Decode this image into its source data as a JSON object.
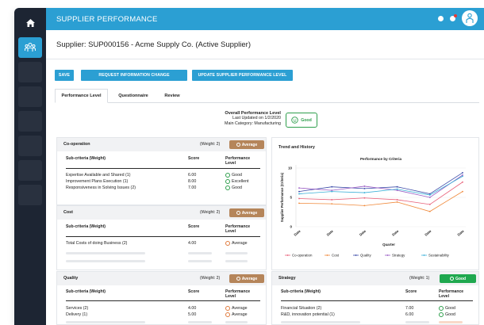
{
  "app": {
    "title": "SUPPLIER PERFORMANCE",
    "accent": "#2b9fd3",
    "sidebar_bg": "#1d2533"
  },
  "sidebar": {
    "items": [
      {
        "icon": "home-icon",
        "active": false
      },
      {
        "icon": "supplier-group-icon",
        "active": true
      },
      {
        "icon": "menu-icon",
        "active": false
      },
      {
        "icon": "menu-icon",
        "active": false
      },
      {
        "icon": "menu-icon",
        "active": false
      },
      {
        "icon": "menu-icon",
        "active": false
      },
      {
        "icon": "menu-icon",
        "active": false
      },
      {
        "icon": "menu-icon",
        "active": false
      },
      {
        "icon": "menu-icon",
        "active": false
      }
    ]
  },
  "topbar": {
    "icons": [
      "status-dot-icon",
      "notification-icon",
      "user-avatar-icon"
    ]
  },
  "supplier_line": "Supplier: SUP000156 - Acme Supply Co. (Active Supplier)",
  "actions": {
    "save": "SAVE",
    "request_change": "REQUEST INFORMATION CHANGE",
    "update_level": "UPDATE SUPPLIER PERFORMANCE LEVEL"
  },
  "tabs": [
    "Performance Level",
    "Questionnaire",
    "Review"
  ],
  "overall": {
    "label": "Overall Performance Level",
    "updated": "Last Updated on 1/2/2020",
    "category": "Main Category: Manufacturing",
    "level": "Good"
  },
  "columns": {
    "subcriteria": "Sub-criteria (Weight)",
    "score": "Score",
    "performance": "Performance Level"
  },
  "panels": {
    "cooperation": {
      "title": "Co-operation",
      "weight": "(Weight: 2)",
      "level": "Average",
      "rows": [
        {
          "name": "Expertise Available and Shared (1)",
          "score": "6.00",
          "level": "Good"
        },
        {
          "name": "Improvement Plans Execution (1)",
          "score": "8.00",
          "level": "Excellent"
        },
        {
          "name": "Responsiveness in Solving Issues (2)",
          "score": "7.00",
          "level": "Good"
        }
      ]
    },
    "cost": {
      "title": "Cost",
      "weight": "(Weight: 2)",
      "level": "Average",
      "rows": [
        {
          "name": "Total Costs of doing Business (2)",
          "score": "4.00",
          "level": "Average"
        }
      ]
    },
    "quality": {
      "title": "Quality",
      "weight": "(Weight: 2)",
      "level": "Average",
      "rows": [
        {
          "name": "Services (2)",
          "score": "4.00",
          "level": "Average"
        },
        {
          "name": "Delivery (1)",
          "score": "5.00",
          "level": "Average"
        }
      ]
    },
    "strategy": {
      "title": "Strategy",
      "weight": "(Weight: 1)",
      "level": "Good",
      "rows": [
        {
          "name": "Financial Situation (2)",
          "score": "7.00",
          "level": "Good"
        },
        {
          "name": "R&D, innovation potential (1)",
          "score": "6.00",
          "level": "Good"
        }
      ]
    }
  },
  "trend": {
    "panel_title": "Trend and History"
  },
  "chart_data": {
    "type": "line",
    "title": "Performance by Criteria",
    "xlabel": "Quarter",
    "ylabel": "Supplier Performance (Criteria)",
    "categories": [
      "Date",
      "Date",
      "Date",
      "Date",
      "Date",
      "Date"
    ],
    "ylim": [
      0,
      10
    ],
    "yticks": [
      0,
      5,
      10
    ],
    "grid": true,
    "legend": "bottom",
    "series": [
      {
        "name": "Co-operation",
        "color": "#e8607a",
        "values": [
          4.8,
          4.6,
          4.9,
          4.6,
          3.8,
          7.6
        ]
      },
      {
        "name": "Cost",
        "color": "#f08a3c",
        "values": [
          4.0,
          3.9,
          3.6,
          4.2,
          2.6,
          6.0
        ]
      },
      {
        "name": "Quality",
        "color": "#3a4aa8",
        "values": [
          6.0,
          6.8,
          6.5,
          6.8,
          5.6,
          9.2
        ]
      },
      {
        "name": "Strategy",
        "color": "#9a5cc4",
        "values": [
          6.6,
          6.2,
          6.9,
          6.2,
          5.0,
          8.8
        ]
      },
      {
        "name": "Sustainability",
        "color": "#3ab0d8",
        "values": [
          5.6,
          6.0,
          5.8,
          6.4,
          5.4,
          8.6
        ]
      }
    ]
  }
}
